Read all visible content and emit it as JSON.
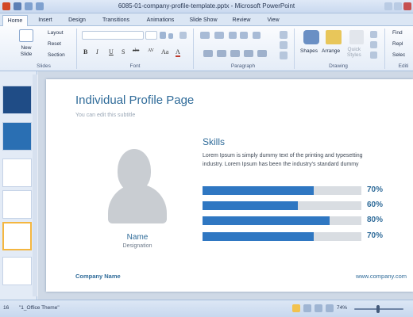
{
  "window": {
    "title": "6085-01-company-profile-template.pptx - Microsoft PowerPoint"
  },
  "tabs": [
    "Home",
    "Insert",
    "Design",
    "Transitions",
    "Animations",
    "Slide Show",
    "Review",
    "View"
  ],
  "ribbon": {
    "new_slide": "New\nSlide",
    "layout": "Layout",
    "reset": "Reset",
    "section": "Section",
    "shapes": "Shapes",
    "arrange": "Arrange",
    "quick_styles": "Quick\nStyles",
    "find": "Find",
    "replace": "Repl",
    "select": "Selec",
    "groups": {
      "slides": "Slides",
      "font": "Font",
      "paragraph": "Paragraph",
      "drawing": "Drawing",
      "editing": "Editi"
    },
    "font_buttons": [
      "B",
      "I",
      "U",
      "S",
      "abc",
      "AV",
      "Aa",
      "A"
    ]
  },
  "slide": {
    "title": "Individual Profile Page",
    "subtitle": "You can edit this subtitle",
    "name": "Name",
    "designation": "Designation",
    "skills_heading": "Skills",
    "skills_text": "Lorem Ipsum is simply dummy text of the printing and typesetting industry. Lorem Ipsum has been the industry's standard dummy",
    "skills": [
      {
        "percent_label": "70%",
        "value": 70
      },
      {
        "percent_label": "60%",
        "value": 60
      },
      {
        "percent_label": "80%",
        "value": 80
      },
      {
        "percent_label": "70%",
        "value": 70
      }
    ],
    "company_name": "Company Name",
    "website": "www.company.com"
  },
  "status": {
    "slide_num": "16",
    "theme": "\"1_Office Theme\"",
    "zoom": "74%"
  },
  "colors": {
    "accent": "#2f77c2",
    "title": "#2f6b99",
    "track": "#d9dde2",
    "silhouette": "#c9cdd2"
  }
}
